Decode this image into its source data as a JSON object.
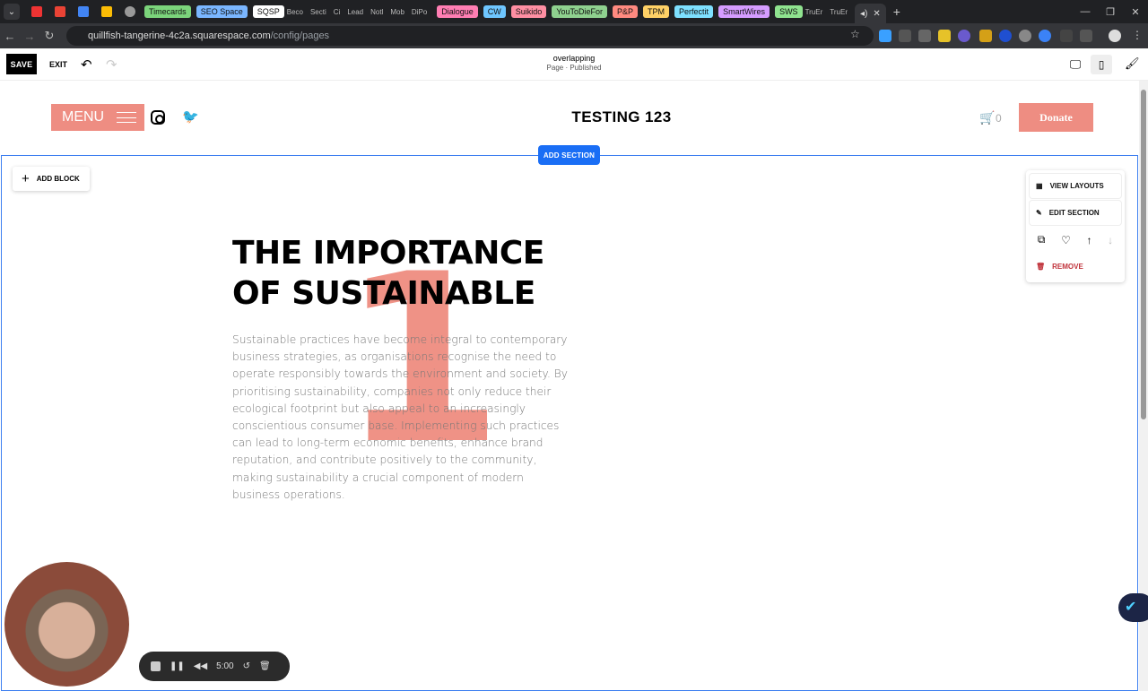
{
  "browser": {
    "tabs": [
      {
        "label": "Timecards",
        "color": "#7bd47b"
      },
      {
        "label": "SEO Space",
        "color": "#7ab6ff"
      },
      {
        "label": "SQSP",
        "color": "#ffffff"
      },
      {
        "label": "Beco",
        "color": ""
      },
      {
        "label": "Secti",
        "color": ""
      },
      {
        "label": "Ci",
        "color": ""
      },
      {
        "label": "Lead",
        "color": ""
      },
      {
        "label": "Notl",
        "color": ""
      },
      {
        "label": "Mob",
        "color": ""
      },
      {
        "label": "DiPo",
        "color": ""
      },
      {
        "label": "Dialogue",
        "color": "#ff7eb3"
      },
      {
        "label": "CW",
        "color": "#6ec6ff"
      },
      {
        "label": "Suikido",
        "color": "#ff8fa3"
      },
      {
        "label": "YouToDieFor",
        "color": "#8fd18f"
      },
      {
        "label": "P&P",
        "color": "#ff8a80"
      },
      {
        "label": "TPM",
        "color": "#ffd166"
      },
      {
        "label": "Perfectit",
        "color": "#7ee0ff"
      },
      {
        "label": "SmartWires",
        "color": "#d59cff"
      },
      {
        "label": "SWS",
        "color": "#8fe38f"
      },
      {
        "label": "TruEr",
        "color": ""
      },
      {
        "label": "TruEr",
        "color": ""
      }
    ],
    "url_host": "quillfish-tangerine-4c2a.squarespace.com",
    "url_path": "/config/pages"
  },
  "editor": {
    "save_label": "SAVE",
    "exit_label": "EXIT",
    "page_title": "overlapping",
    "page_status": "Page · Published"
  },
  "site": {
    "menu_label": "MENU",
    "title": "TESTING 123",
    "cart_count": "0",
    "donate_label": "Donate",
    "add_section_label": "ADD SECTION",
    "add_block_label": "ADD BLOCK",
    "big_number": "1",
    "heading": "THE IMPORTANCE OF SUSTAINABLE",
    "body": "Sustainable practices have become integral to contemporary business strategies, as organisations recognise the need to operate responsibly towards the environment and society. By prioritising sustainability, companies not only reduce their ecological footprint but also appeal to an increasingly conscientious consumer base. Implementing such practices can lead to long-term economic benefits, enhance brand reputation, and contribute positively to the community, making sustainability a crucial component of modern business operations."
  },
  "section_menu": {
    "view_layouts": "VIEW LAYOUTS",
    "edit_section": "EDIT SECTION",
    "remove": "REMOVE"
  },
  "recorder": {
    "time": "5:00"
  },
  "colors": {
    "accent": "#ee8d82",
    "editor_blue": "#1a6ef5"
  }
}
